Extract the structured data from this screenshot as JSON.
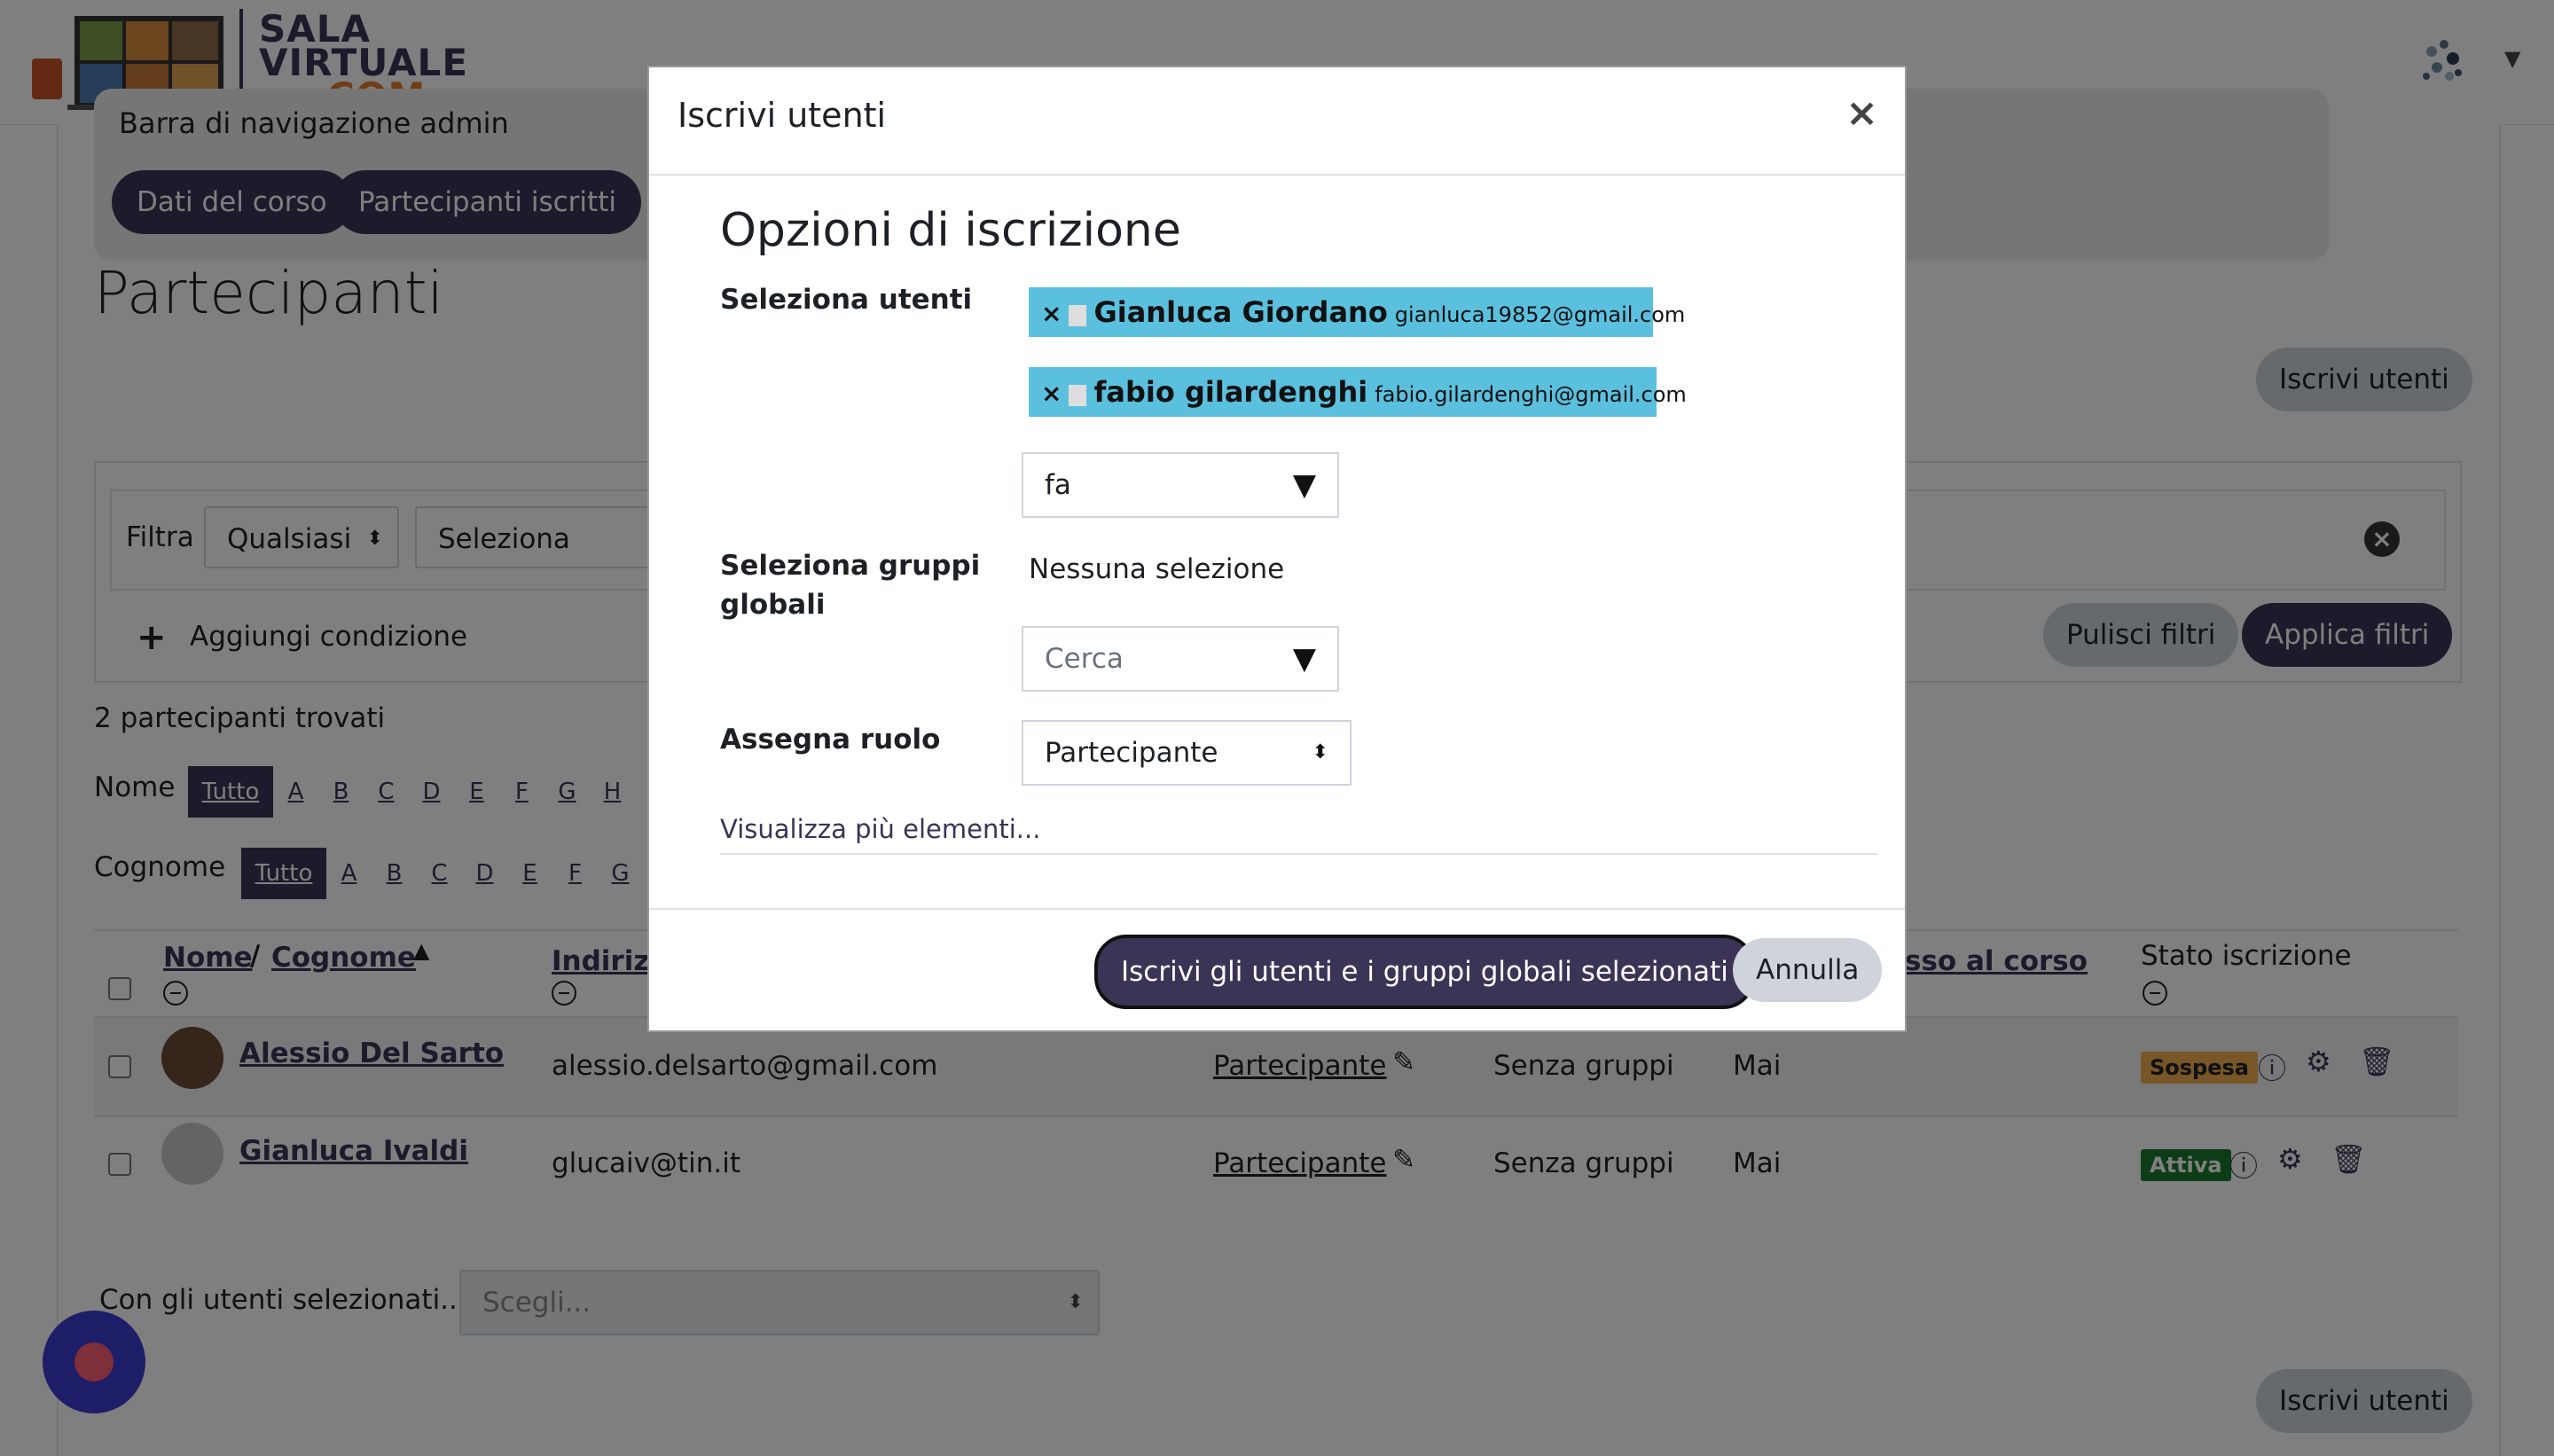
{
  "brand": {
    "line1": "SALA",
    "line2": "VIRTUALE",
    "line3": ".COM"
  },
  "admin_nav": {
    "title": "Barra di navigazione admin",
    "pills": [
      "Dati del corso",
      "Partecipanti iscritti"
    ]
  },
  "page": {
    "title": "Partecipanti",
    "enrol_button": "Iscrivi utenti"
  },
  "filters": {
    "label": "Filtra",
    "match_select": "Qualsiasi",
    "type_select": "Seleziona",
    "add_condition": "Aggiungi condizione",
    "clear": "Pulisci filtri",
    "apply": "Applica filtri"
  },
  "results": {
    "count_text": "2 partecipanti trovati",
    "first_name_label": "Nome",
    "last_name_label": "Cognome",
    "all_label": "Tutto",
    "first_letters": [
      "A",
      "B",
      "C",
      "D",
      "E",
      "F",
      "G",
      "H"
    ],
    "last_letters": [
      "A",
      "B",
      "C",
      "D",
      "E",
      "F",
      "G"
    ]
  },
  "table": {
    "col_name": "Nome",
    "col_sep": "/",
    "col_surname": "Cognome",
    "col_email": "Indirizz",
    "col_access": "sso al corso",
    "col_status": "Stato iscrizione",
    "rows": [
      {
        "name": "Alessio Del Sarto",
        "email": "alessio.delsarto@gmail.com",
        "role": "Partecipante",
        "groups": "Senza gruppi",
        "access": "Mai",
        "status": "Sospesa"
      },
      {
        "name": "Gianluca Ivaldi",
        "email": "glucaiv@tin.it",
        "role": "Partecipante",
        "groups": "Senza gruppi",
        "access": "Mai",
        "status": "Attiva"
      }
    ]
  },
  "bulk": {
    "label": "Con gli utenti selezionati...",
    "placeholder": "Scegli..."
  },
  "modal": {
    "title": "Iscrivi utenti",
    "section_title": "Opzioni di iscrizione",
    "select_users_label": "Seleziona utenti",
    "selected_users": [
      {
        "name": "Gianluca Giordano",
        "email": "gianluca19852@gmail.com"
      },
      {
        "name": "fabio gilardenghi",
        "email": "fabio.gilardenghi@gmail.com"
      }
    ],
    "user_search_value": "fa",
    "cohorts_label": "Seleziona gruppi globali",
    "cohorts_none": "Nessuna selezione",
    "cohorts_search_placeholder": "Cerca",
    "role_label": "Assegna ruolo",
    "role_value": "Partecipante",
    "more_link": "Visualizza più elementi...",
    "submit": "Iscrivi gli utenti e i gruppi globali selezionati",
    "cancel": "Annulla"
  },
  "colors": {
    "primary": "#3b3456",
    "chip": "#5bc0de",
    "suspended": "#f0ad4e",
    "active": "#1b7a2e",
    "fab": "#3b3bd0"
  }
}
